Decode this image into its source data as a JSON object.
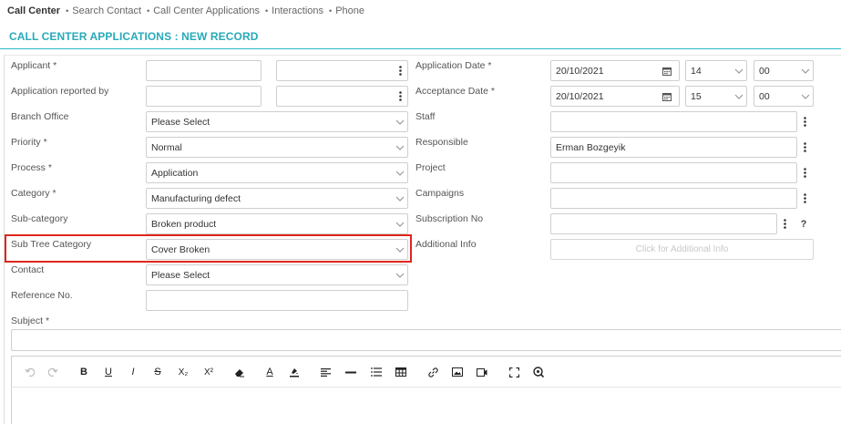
{
  "breadcrumb": {
    "items": [
      "Call Center",
      "Search Contact",
      "Call Center Applications",
      "Interactions",
      "Phone"
    ]
  },
  "page": {
    "title": "CALL CENTER APPLICATIONS : NEW RECORD"
  },
  "left_form": {
    "applicant_label": "Applicant *",
    "reported_by_label": "Application reported by",
    "branch_office_label": "Branch Office",
    "branch_office_value": "Please Select",
    "priority_label": "Priority *",
    "priority_value": "Normal",
    "process_label": "Process *",
    "process_value": "Application",
    "category_label": "Category *",
    "category_value": "Manufacturing defect",
    "subcategory_label": "Sub-category",
    "subcategory_value": "Broken product",
    "subtree_label": "Sub Tree Category",
    "subtree_value": "Cover Broken",
    "contact_label": "Contact",
    "contact_value": "Please Select",
    "reference_label": "Reference No.",
    "subject_label": "Subject *"
  },
  "right_form": {
    "application_date_label": "Application Date *",
    "application_date_value": "20/10/2021",
    "application_hour": "14",
    "application_minute": "00",
    "acceptance_date_label": "Acceptance Date *",
    "acceptance_date_value": "20/10/2021",
    "acceptance_hour": "15",
    "acceptance_minute": "00",
    "staff_label": "Staff",
    "responsible_label": "Responsible",
    "responsible_value": "Erman Bozgeyik",
    "project_label": "Project",
    "campaigns_label": "Campaigns",
    "subscription_label": "Subscription No",
    "additional_info_label": "Additional Info",
    "additional_info_button": "Click for Additional Info",
    "help_glyph": "?"
  },
  "editor_toolbar": {
    "bold": "B",
    "underline": "U",
    "italic": "I",
    "strike": "S",
    "subscript": "X₂",
    "superscript": "X²",
    "font_color": "A"
  },
  "colors": {
    "accent": "#27aab8",
    "highlight": "#e0261d"
  }
}
